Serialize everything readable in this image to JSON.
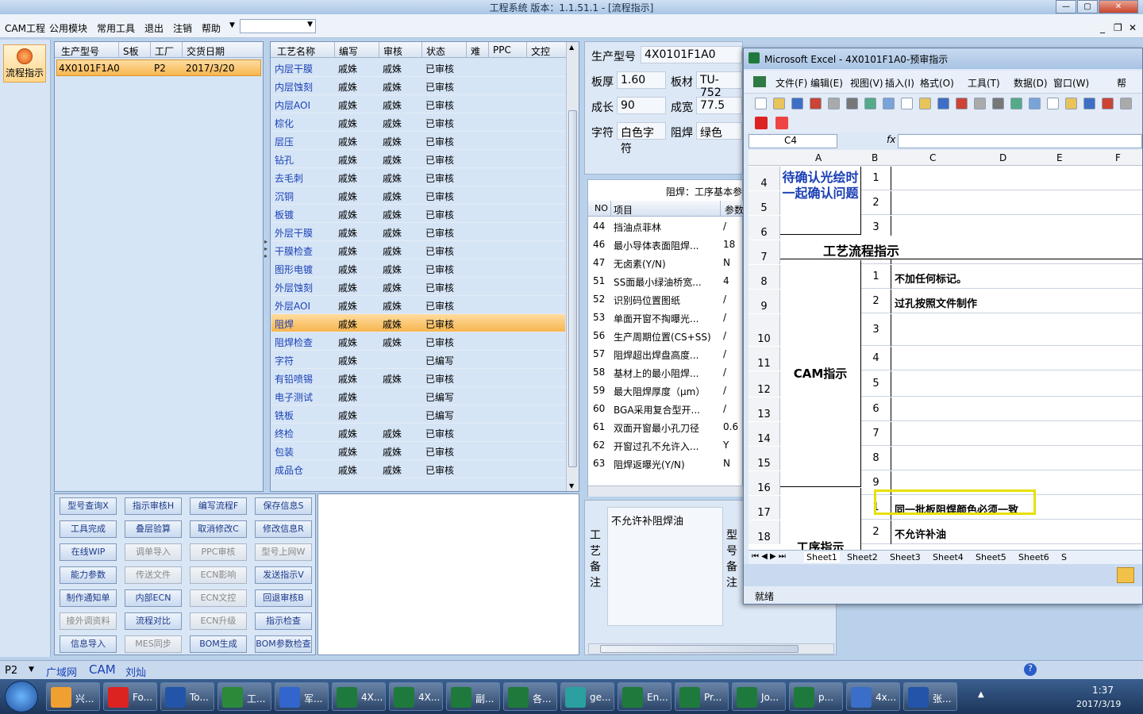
{
  "window": {
    "title": "工程系统   版本：1.1.51.1 - [流程指示]"
  },
  "menu": [
    "CAM工程",
    "公用模块",
    "常用工具",
    "退出",
    "注销",
    "帮助"
  ],
  "sidebar": {
    "flow_label": "流程指示"
  },
  "model_table": {
    "headers": [
      "生产型号",
      "S板",
      "工厂",
      "交货日期"
    ],
    "rows": [
      [
        "4X0101F1A0",
        "",
        "P2",
        "2017/3/20"
      ]
    ]
  },
  "process_table": {
    "headers": [
      "工艺名称",
      "编写",
      "审核",
      "状态",
      "难",
      "PPC",
      "文控"
    ],
    "rows": [
      [
        "内层干膜",
        "戚姝",
        "戚姝",
        "已审核"
      ],
      [
        "内层蚀刻",
        "戚姝",
        "戚姝",
        "已审核"
      ],
      [
        "内层AOI",
        "戚姝",
        "戚姝",
        "已审核"
      ],
      [
        "棕化",
        "戚姝",
        "戚姝",
        "已审核"
      ],
      [
        "层压",
        "戚姝",
        "戚姝",
        "已审核"
      ],
      [
        "钻孔",
        "戚姝",
        "戚姝",
        "已审核"
      ],
      [
        "去毛刺",
        "戚姝",
        "戚姝",
        "已审核"
      ],
      [
        "沉铜",
        "戚姝",
        "戚姝",
        "已审核"
      ],
      [
        "板镀",
        "戚姝",
        "戚姝",
        "已审核"
      ],
      [
        "外层干膜",
        "戚姝",
        "戚姝",
        "已审核"
      ],
      [
        "干膜检查",
        "戚姝",
        "戚姝",
        "已审核"
      ],
      [
        "图形电镀",
        "戚姝",
        "戚姝",
        "已审核"
      ],
      [
        "外层蚀刻",
        "戚姝",
        "戚姝",
        "已审核"
      ],
      [
        "外层AOI",
        "戚姝",
        "戚姝",
        "已审核"
      ],
      [
        "阻焊",
        "戚姝",
        "戚姝",
        "已审核"
      ],
      [
        "阻焊检查",
        "戚姝",
        "戚姝",
        "已审核"
      ],
      [
        "字符",
        "戚姝",
        "",
        "已编写"
      ],
      [
        "有铅喷锡",
        "戚姝",
        "戚姝",
        "已审核"
      ],
      [
        "电子测试",
        "戚姝",
        "",
        "已编写"
      ],
      [
        "铣板",
        "戚姝",
        "",
        "已编写"
      ],
      [
        "终检",
        "戚姝",
        "戚姝",
        "已审核"
      ],
      [
        "包装",
        "戚姝",
        "戚姝",
        "已审核"
      ],
      [
        "成品仓",
        "戚姝",
        "戚姝",
        "已审核"
      ]
    ],
    "selected_index": 14
  },
  "buttons": [
    [
      "型号查询X",
      "指示审核H",
      "编写流程F",
      "保存信息S"
    ],
    [
      "工具完成",
      "叠层验算",
      "取消修改C",
      "修改信息R"
    ],
    [
      "在线WIP",
      "调单导入",
      "PPC审核",
      "型号上网W"
    ],
    [
      "能力参数",
      "传送文件",
      "ECN影响",
      "发送指示V"
    ],
    [
      "制作通知单",
      "内部ECN",
      "ECN文控",
      "回退审核B"
    ],
    [
      "接外调资料",
      "流程对比",
      "ECN升级",
      "指示检查"
    ],
    [
      "信息导入",
      "MES同步",
      "BOM生成",
      "BOM参数检查"
    ]
  ],
  "info": {
    "model_label": "生产型号",
    "model_value": "4X0101F1A0",
    "thick_label": "板厚",
    "thick_value": "1.60",
    "material_label": "板材",
    "material_value": "TU-752",
    "len_label": "成长",
    "len_value": "90",
    "width_label": "成宽",
    "width_value": "77.5",
    "char_label": "字符",
    "char_value": "白色字符",
    "mask_label": "阻焊",
    "mask_value": "绿色"
  },
  "params": {
    "title": "阻焊：工序基本参",
    "headers": [
      "NO",
      "项目",
      "参数"
    ],
    "rows": [
      [
        "44",
        "挡油点菲林",
        "/"
      ],
      [
        "46",
        "最小导体表面阻焊...",
        "18"
      ],
      [
        "47",
        "无卤素(Y/N)",
        "N"
      ],
      [
        "51",
        "SS面最小绿油桥宽...",
        "4"
      ],
      [
        "52",
        "识别码位置图纸",
        "/"
      ],
      [
        "53",
        "单面开窗不掏曝光...",
        "/"
      ],
      [
        "56",
        "生产周期位置(CS+SS)",
        "/"
      ],
      [
        "57",
        "阻焊超出焊盘高度...",
        "/"
      ],
      [
        "58",
        "基材上的最小阻焊...",
        "/"
      ],
      [
        "59",
        "最大阻焊厚度（μm）",
        "/"
      ],
      [
        "60",
        "BGA采用复合型开...",
        "/"
      ],
      [
        "61",
        "双面开窗最小孔刀径",
        "0.6"
      ],
      [
        "62",
        "开窗过孔不允许入...",
        "Y"
      ],
      [
        "63",
        "阻焊返曝光(Y/N)",
        "N"
      ]
    ]
  },
  "remarks": {
    "craft_label": "工艺备注",
    "craft_text": "不允许补阻焊油",
    "model_label": "型号备注"
  },
  "excel": {
    "title": "Microsoft Excel - 4X0101F1A0-预审指示",
    "menu": [
      "文件(F)",
      "编辑(E)",
      "视图(V)",
      "插入(I)",
      "格式(O)",
      "工具(T)",
      "数据(D)",
      "窗口(W)",
      "帮"
    ],
    "name_box": "C4",
    "cols": [
      "A",
      "B",
      "C",
      "D",
      "E",
      "F"
    ],
    "rows": [
      {
        "n": "4",
        "b": "1",
        "c": ""
      },
      {
        "n": "5",
        "b": "2",
        "c": ""
      },
      {
        "n": "6",
        "b": "3",
        "c": ""
      },
      {
        "n": "7",
        "b": "",
        "c": ""
      },
      {
        "n": "8",
        "b": "1",
        "c": "不加任何标记。"
      },
      {
        "n": "9",
        "b": "2",
        "c": "过孔按照文件制作"
      },
      {
        "n": "10",
        "b": "3",
        "c": ""
      },
      {
        "n": "11",
        "b": "4",
        "c": ""
      },
      {
        "n": "12",
        "b": "5",
        "c": ""
      },
      {
        "n": "13",
        "b": "6",
        "c": ""
      },
      {
        "n": "14",
        "b": "7",
        "c": ""
      },
      {
        "n": "15",
        "b": "8",
        "c": ""
      },
      {
        "n": "16",
        "b": "9",
        "c": ""
      },
      {
        "n": "17",
        "b": "1",
        "c": "同一批板阻焊颜色必须一致"
      },
      {
        "n": "18",
        "b": "2",
        "c": "不允许补油"
      }
    ],
    "merged_a1": "待确认光绘时一起确认问题",
    "merged_a2": "工艺流程指示",
    "merged_a3": "CAM指示",
    "merged_a4": "工序指示",
    "sheets": [
      "Sheet1",
      "Sheet2",
      "Sheet3",
      "Sheet4",
      "Sheet5",
      "Sheet6",
      "S"
    ],
    "status": "就绪"
  },
  "statusbar": {
    "plant": "P2",
    "network": "广域网",
    "module": "CAM",
    "user": "刘灿"
  },
  "taskbar": {
    "items": [
      "兴...",
      "Fo...",
      "To...",
      "工...",
      "军...",
      "4X...",
      "4X...",
      "副...",
      "各...",
      "ge...",
      "En...",
      "Pr...",
      "Jo...",
      "p...",
      "4x...",
      "张..."
    ],
    "time": "1:37",
    "date": "2017/3/19"
  },
  "colors": {
    "accent_select": "#f7b64e",
    "excel_highlight": "#e8e000",
    "text_blue": "#1a3fb5"
  }
}
